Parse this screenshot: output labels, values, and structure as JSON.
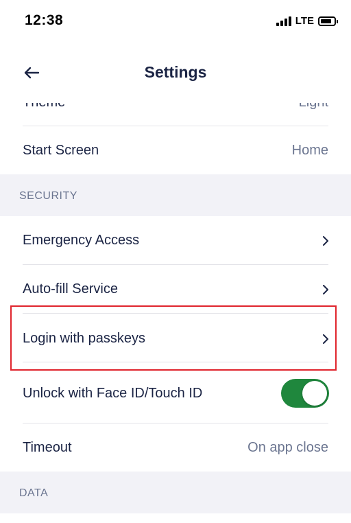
{
  "status_bar": {
    "time": "12:38",
    "network": "LTE"
  },
  "header": {
    "title": "Settings"
  },
  "rows_top": [
    {
      "label": "Theme",
      "value": "Light"
    },
    {
      "label": "Start Screen",
      "value": "Home"
    }
  ],
  "sections": [
    {
      "title": "SECURITY"
    },
    {
      "title": "DATA"
    }
  ],
  "security_items": [
    {
      "label": "Emergency Access"
    },
    {
      "label": "Auto-fill Service"
    },
    {
      "label": "Login with passkeys"
    },
    {
      "label": "Unlock with Face ID/Touch ID",
      "toggle": true
    },
    {
      "label": "Timeout",
      "value": "On app close"
    }
  ],
  "colors": {
    "accent_toggle": "#1f873d",
    "highlight": "#e0242c",
    "section_bg": "#f2f2f7"
  }
}
